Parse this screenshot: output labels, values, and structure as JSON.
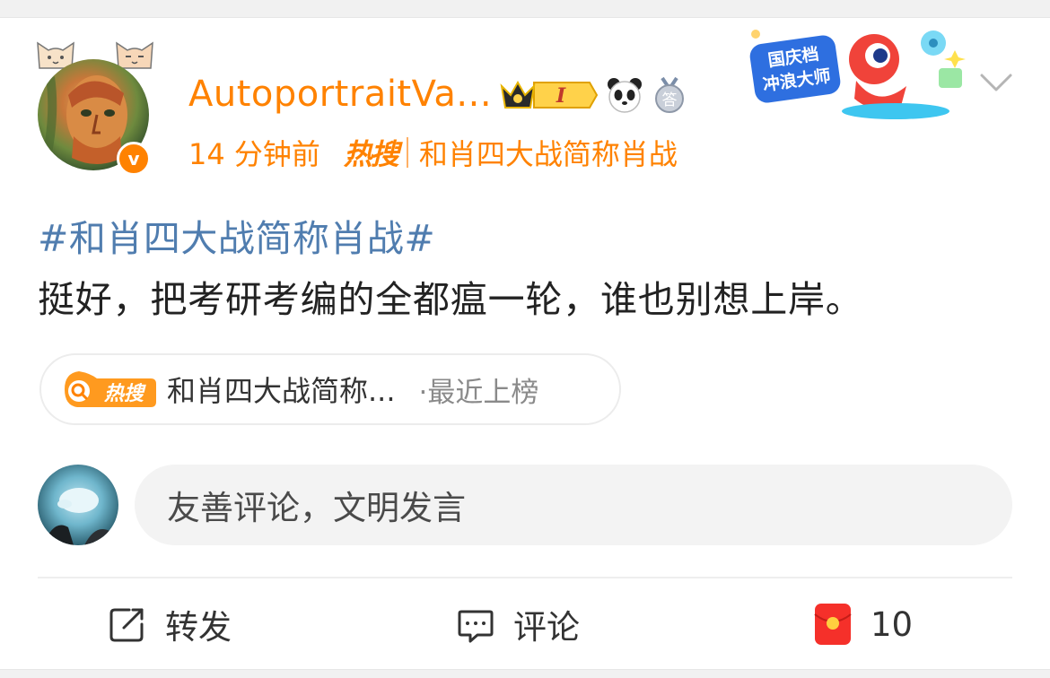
{
  "post": {
    "username": "AutoportraitVa...",
    "time": "14 分钟前",
    "hot_mark": "热搜",
    "topic_source": "和肖四大战简称肖战",
    "hashtag": "#和肖四大战简称肖战#",
    "text": "挺好，把考研考编的全都瘟一轮，谁也别想上岸。"
  },
  "badges": {
    "level_numeral": "I",
    "answer_glyph": "答",
    "verified_glyph": "v"
  },
  "promo": {
    "line1": "国庆档",
    "line2": "冲浪大师"
  },
  "hot_pill": {
    "icon_text": "热搜",
    "title": "和肖四大战简称...",
    "note": "·最近上榜"
  },
  "comment_input": {
    "placeholder": "友善评论，文明发言"
  },
  "actions": {
    "repost": "转发",
    "comment": "评论",
    "like_count": "10"
  },
  "colors": {
    "accent": "#ff8200",
    "hashtag": "#507daf",
    "text": "#222222",
    "muted": "#8a8a8a"
  },
  "icons": [
    "cat-ears-icon",
    "verified-icon",
    "crown-level-icon",
    "panda-icon",
    "answer-medal-icon",
    "chevron-down-icon",
    "search-icon",
    "repost-icon",
    "comment-icon",
    "red-envelope-icon"
  ]
}
